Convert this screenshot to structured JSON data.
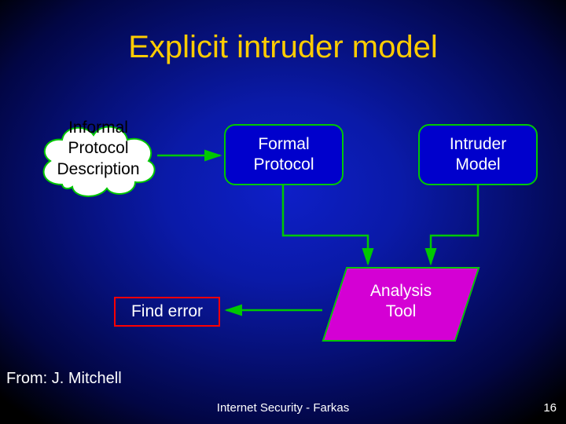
{
  "title": "Explicit intruder model",
  "nodes": {
    "informal": "Informal\nProtocol\nDescription",
    "formal": "Formal\nProtocol",
    "intruder": "Intruder\nModel",
    "analysis": "Analysis\nTool",
    "find_error": "Find error"
  },
  "attribution": "From: J. Mitchell",
  "footer": "Internet Security - Farkas",
  "page_number": "16",
  "colors": {
    "title": "#ffcc00",
    "box_fill": "#0000cc",
    "box_border": "#00c800",
    "para_fill": "#d400d4",
    "error_border": "#ff0000",
    "arrow": "#00c800"
  }
}
